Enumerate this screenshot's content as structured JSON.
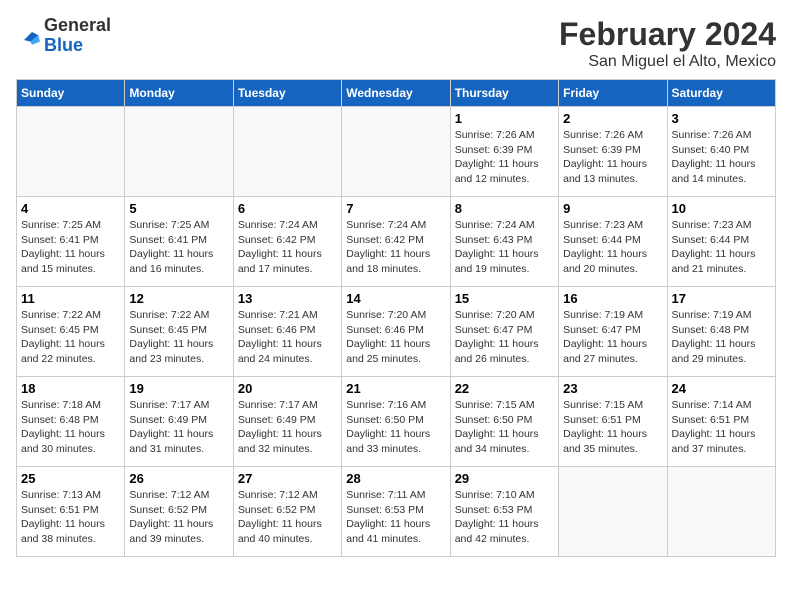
{
  "logo": {
    "line1": "General",
    "line2": "Blue"
  },
  "title": "February 2024",
  "subtitle": "San Miguel el Alto, Mexico",
  "weekdays": [
    "Sunday",
    "Monday",
    "Tuesday",
    "Wednesday",
    "Thursday",
    "Friday",
    "Saturday"
  ],
  "weeks": [
    [
      {
        "day": "",
        "info": ""
      },
      {
        "day": "",
        "info": ""
      },
      {
        "day": "",
        "info": ""
      },
      {
        "day": "",
        "info": ""
      },
      {
        "day": "1",
        "info": "Sunrise: 7:26 AM\nSunset: 6:39 PM\nDaylight: 11 hours\nand 12 minutes."
      },
      {
        "day": "2",
        "info": "Sunrise: 7:26 AM\nSunset: 6:39 PM\nDaylight: 11 hours\nand 13 minutes."
      },
      {
        "day": "3",
        "info": "Sunrise: 7:26 AM\nSunset: 6:40 PM\nDaylight: 11 hours\nand 14 minutes."
      }
    ],
    [
      {
        "day": "4",
        "info": "Sunrise: 7:25 AM\nSunset: 6:41 PM\nDaylight: 11 hours\nand 15 minutes."
      },
      {
        "day": "5",
        "info": "Sunrise: 7:25 AM\nSunset: 6:41 PM\nDaylight: 11 hours\nand 16 minutes."
      },
      {
        "day": "6",
        "info": "Sunrise: 7:24 AM\nSunset: 6:42 PM\nDaylight: 11 hours\nand 17 minutes."
      },
      {
        "day": "7",
        "info": "Sunrise: 7:24 AM\nSunset: 6:42 PM\nDaylight: 11 hours\nand 18 minutes."
      },
      {
        "day": "8",
        "info": "Sunrise: 7:24 AM\nSunset: 6:43 PM\nDaylight: 11 hours\nand 19 minutes."
      },
      {
        "day": "9",
        "info": "Sunrise: 7:23 AM\nSunset: 6:44 PM\nDaylight: 11 hours\nand 20 minutes."
      },
      {
        "day": "10",
        "info": "Sunrise: 7:23 AM\nSunset: 6:44 PM\nDaylight: 11 hours\nand 21 minutes."
      }
    ],
    [
      {
        "day": "11",
        "info": "Sunrise: 7:22 AM\nSunset: 6:45 PM\nDaylight: 11 hours\nand 22 minutes."
      },
      {
        "day": "12",
        "info": "Sunrise: 7:22 AM\nSunset: 6:45 PM\nDaylight: 11 hours\nand 23 minutes."
      },
      {
        "day": "13",
        "info": "Sunrise: 7:21 AM\nSunset: 6:46 PM\nDaylight: 11 hours\nand 24 minutes."
      },
      {
        "day": "14",
        "info": "Sunrise: 7:20 AM\nSunset: 6:46 PM\nDaylight: 11 hours\nand 25 minutes."
      },
      {
        "day": "15",
        "info": "Sunrise: 7:20 AM\nSunset: 6:47 PM\nDaylight: 11 hours\nand 26 minutes."
      },
      {
        "day": "16",
        "info": "Sunrise: 7:19 AM\nSunset: 6:47 PM\nDaylight: 11 hours\nand 27 minutes."
      },
      {
        "day": "17",
        "info": "Sunrise: 7:19 AM\nSunset: 6:48 PM\nDaylight: 11 hours\nand 29 minutes."
      }
    ],
    [
      {
        "day": "18",
        "info": "Sunrise: 7:18 AM\nSunset: 6:48 PM\nDaylight: 11 hours\nand 30 minutes."
      },
      {
        "day": "19",
        "info": "Sunrise: 7:17 AM\nSunset: 6:49 PM\nDaylight: 11 hours\nand 31 minutes."
      },
      {
        "day": "20",
        "info": "Sunrise: 7:17 AM\nSunset: 6:49 PM\nDaylight: 11 hours\nand 32 minutes."
      },
      {
        "day": "21",
        "info": "Sunrise: 7:16 AM\nSunset: 6:50 PM\nDaylight: 11 hours\nand 33 minutes."
      },
      {
        "day": "22",
        "info": "Sunrise: 7:15 AM\nSunset: 6:50 PM\nDaylight: 11 hours\nand 34 minutes."
      },
      {
        "day": "23",
        "info": "Sunrise: 7:15 AM\nSunset: 6:51 PM\nDaylight: 11 hours\nand 35 minutes."
      },
      {
        "day": "24",
        "info": "Sunrise: 7:14 AM\nSunset: 6:51 PM\nDaylight: 11 hours\nand 37 minutes."
      }
    ],
    [
      {
        "day": "25",
        "info": "Sunrise: 7:13 AM\nSunset: 6:51 PM\nDaylight: 11 hours\nand 38 minutes."
      },
      {
        "day": "26",
        "info": "Sunrise: 7:12 AM\nSunset: 6:52 PM\nDaylight: 11 hours\nand 39 minutes."
      },
      {
        "day": "27",
        "info": "Sunrise: 7:12 AM\nSunset: 6:52 PM\nDaylight: 11 hours\nand 40 minutes."
      },
      {
        "day": "28",
        "info": "Sunrise: 7:11 AM\nSunset: 6:53 PM\nDaylight: 11 hours\nand 41 minutes."
      },
      {
        "day": "29",
        "info": "Sunrise: 7:10 AM\nSunset: 6:53 PM\nDaylight: 11 hours\nand 42 minutes."
      },
      {
        "day": "",
        "info": ""
      },
      {
        "day": "",
        "info": ""
      }
    ]
  ]
}
